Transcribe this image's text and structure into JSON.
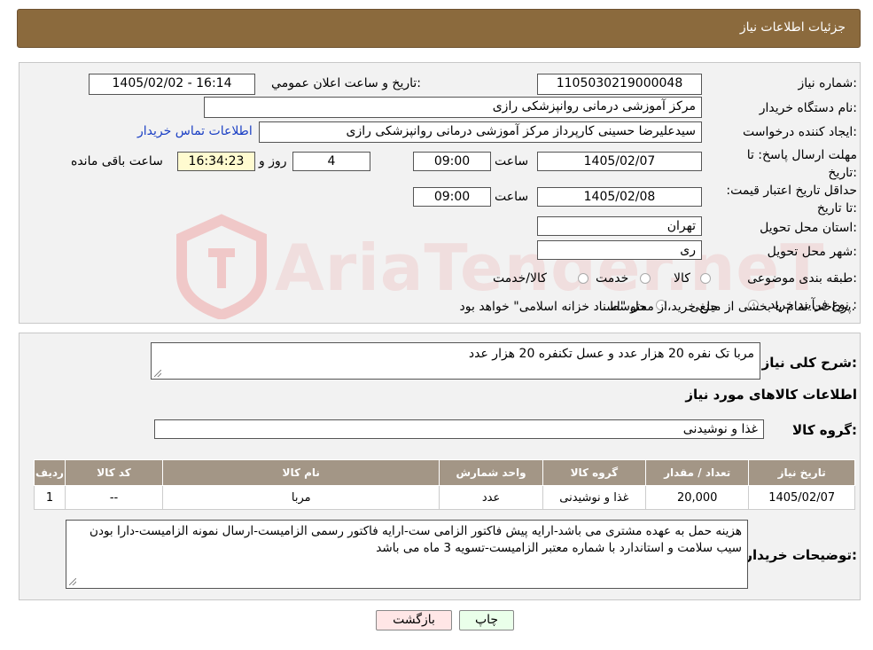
{
  "header": {
    "title": "جزئیات اطلاعات نیاز"
  },
  "watermark": {
    "text": "AriaTender.neT"
  },
  "form": {
    "need_number_label": "شماره نیاز:",
    "need_number": "1105030219000048",
    "announce_label": "تاریخ و ساعت اعلان عمومي:",
    "announce_value": "1405/02/02 - 16:14",
    "buyer_org_label": "نام دستگاه خریدار:",
    "buyer_org": "مرکز آموزشی درمانی روانپزشکی رازی",
    "creator_label": "ایجاد کننده درخواست:",
    "creator": "سیدعلیرضا حسینی کارپرداز مرکز آموزشی درمانی روانپزشکی رازی",
    "contact_link": "اطلاعات تماس خریدار",
    "deadline_label": "مهلت ارسال پاسخ: تا تاریخ:",
    "deadline_date": "1405/02/07",
    "time_label": "ساعت",
    "deadline_time": "09:00",
    "days_value": "4",
    "days_label": "روز و",
    "remaining_time": "16:34:23",
    "remaining_label": "ساعت باقی مانده",
    "validity_label": "حداقل تاریخ اعتبار قیمت: تا تاریخ:",
    "validity_date": "1405/02/08",
    "validity_time": "09:00",
    "province_label": "استان محل تحویل:",
    "province": "تهران",
    "city_label": "شهر محل تحویل:",
    "city": "ری",
    "category_label": "طبقه بندی موضوعی:",
    "category_options": [
      "کالا",
      "خدمت",
      "کالا/خدمت"
    ],
    "process_label": "نوع فرآیند خرید :",
    "process_options": [
      "جزیی",
      "متوسط"
    ],
    "process_note": "پرداخت تمام یا بخشی از مبلغ خرید،از محل \"اسناد خزانه اسلامی\" خواهد بود."
  },
  "description": {
    "label": "شرح کلی نیاز:",
    "text": "مربا تک نفره 20 هزار عدد و عسل تکنفره 20 هزار عدد"
  },
  "goods": {
    "section_title": "اطلاعات کالاهای مورد نیاز",
    "group_label": "گروه کالا:",
    "group_value": "غذا و نوشیدنی",
    "table": {
      "headers": [
        "ردیف",
        "کد کالا",
        "نام کالا",
        "واحد شمارش",
        "گروه کالا",
        "تعداد / مقدار",
        "تاریخ نیاز"
      ],
      "rows": [
        [
          "1",
          "--",
          "مربا",
          "عدد",
          "غذا و نوشیدنی",
          "20,000",
          "1405/02/07"
        ]
      ]
    },
    "buyer_notes_label": "توضیحات خریدار:",
    "buyer_notes": "هزینه حمل به عهده مشتری می باشد-ارایه پیش فاکتور الزامی ست-ارایه فاکتور رسمی الزامیست-ارسال نمونه الزامیست-دارا بودن سیب سلامت و استاندارد با شماره معتبر الزامیست-تسویه 3 ماه می باشد"
  },
  "buttons": {
    "print": "چاپ",
    "back": "بازگشت"
  },
  "colors": {
    "header_bg": "#8b6a3d",
    "table_header_bg": "#a39686",
    "link": "#1a3fc4",
    "timer_bg": "#fffbd0"
  }
}
